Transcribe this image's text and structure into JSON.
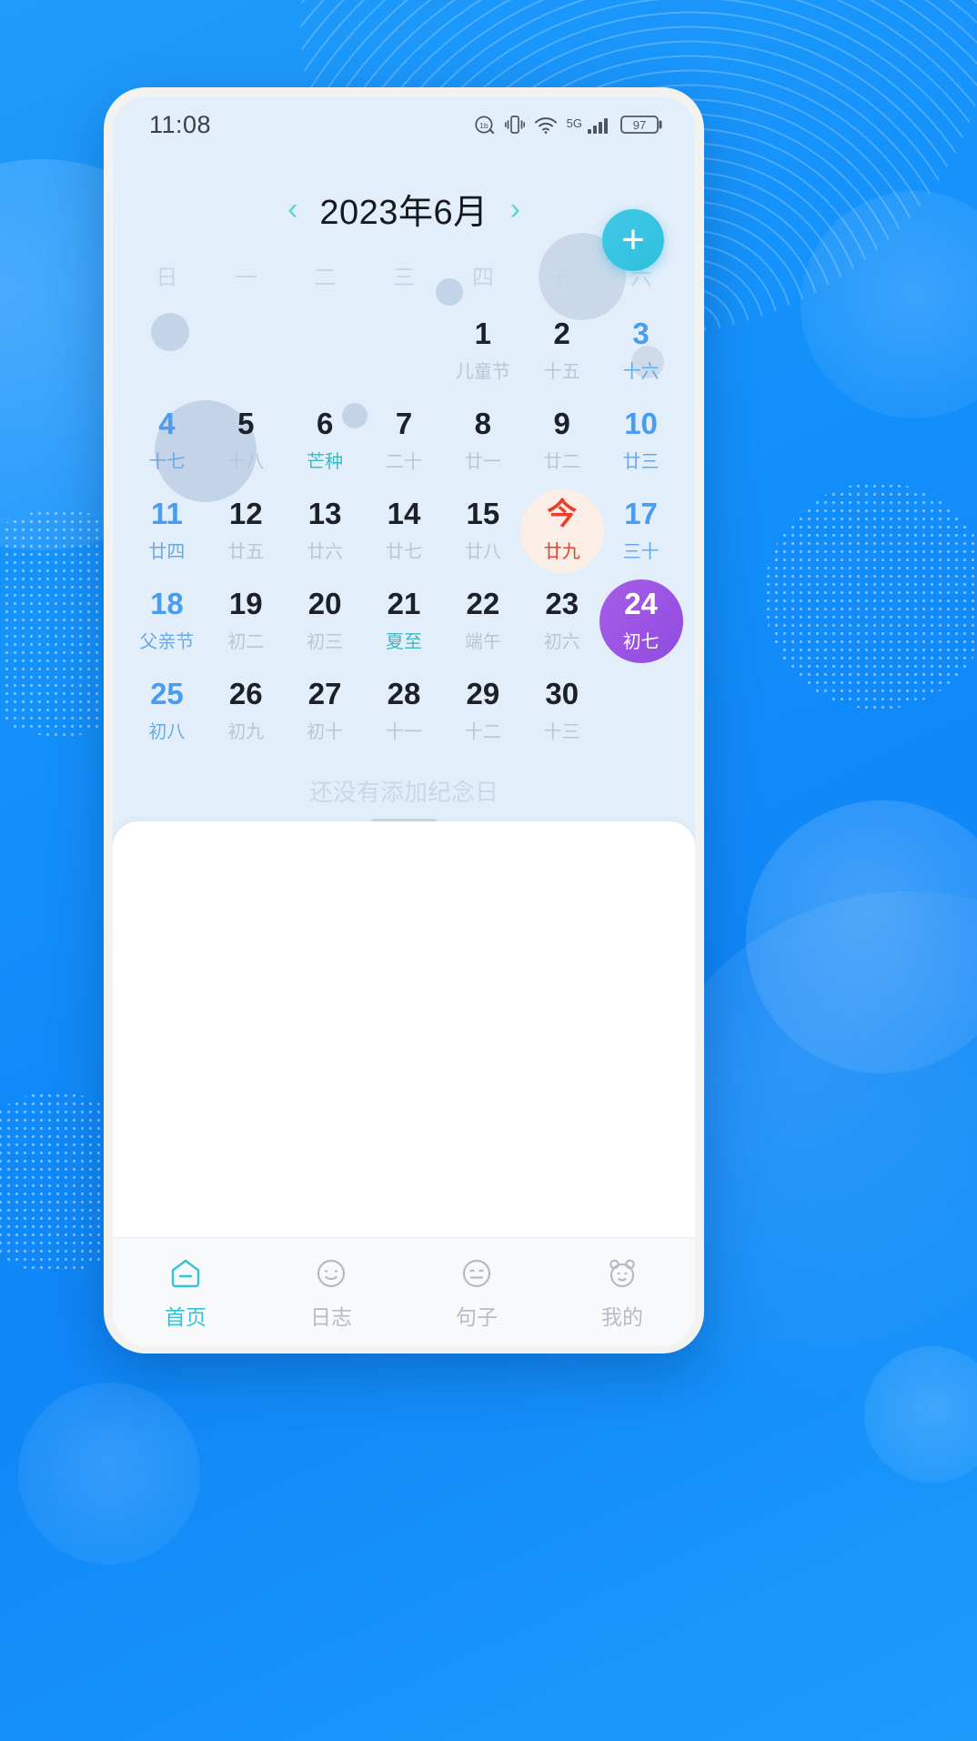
{
  "status_bar": {
    "time": "11:08",
    "network_label": "5G",
    "battery_percent": "97",
    "icons": [
      "alarm-icon",
      "vibrate-icon",
      "wifi-icon",
      "signal-icon",
      "battery-icon"
    ]
  },
  "calendar": {
    "prev_label": "‹",
    "next_label": "›",
    "month_title": "2023年6月",
    "add_label": "+",
    "weekdays": [
      "日",
      "一",
      "二",
      "三",
      "四",
      "五",
      "六"
    ],
    "empty_hint": "还没有添加纪念日",
    "accent_today": "#e8402c",
    "accent_selected": "#8e4ce0",
    "accent_term": "#3fb8c4",
    "accent_weekend": "#4a9cf0",
    "days": [
      {
        "num": "",
        "lunar": "",
        "kind": "empty"
      },
      {
        "num": "",
        "lunar": "",
        "kind": "empty"
      },
      {
        "num": "",
        "lunar": "",
        "kind": "empty"
      },
      {
        "num": "",
        "lunar": "",
        "kind": "empty"
      },
      {
        "num": "1",
        "lunar": "儿童节",
        "kind": "fest"
      },
      {
        "num": "2",
        "lunar": "十五",
        "kind": "normal"
      },
      {
        "num": "3",
        "lunar": "十六",
        "kind": "sat"
      },
      {
        "num": "4",
        "lunar": "十七",
        "kind": "sun"
      },
      {
        "num": "5",
        "lunar": "十八",
        "kind": "normal"
      },
      {
        "num": "6",
        "lunar": "芒种",
        "kind": "term"
      },
      {
        "num": "7",
        "lunar": "二十",
        "kind": "normal"
      },
      {
        "num": "8",
        "lunar": "廿一",
        "kind": "normal"
      },
      {
        "num": "9",
        "lunar": "廿二",
        "kind": "normal"
      },
      {
        "num": "10",
        "lunar": "廿三",
        "kind": "sat"
      },
      {
        "num": "11",
        "lunar": "廿四",
        "kind": "sun"
      },
      {
        "num": "12",
        "lunar": "廿五",
        "kind": "normal"
      },
      {
        "num": "13",
        "lunar": "廿六",
        "kind": "normal"
      },
      {
        "num": "14",
        "lunar": "廿七",
        "kind": "normal"
      },
      {
        "num": "15",
        "lunar": "廿八",
        "kind": "normal"
      },
      {
        "num": "今",
        "lunar": "廿九",
        "kind": "today"
      },
      {
        "num": "17",
        "lunar": "三十",
        "kind": "sat"
      },
      {
        "num": "18",
        "lunar": "父亲节",
        "kind": "sun"
      },
      {
        "num": "19",
        "lunar": "初二",
        "kind": "normal"
      },
      {
        "num": "20",
        "lunar": "初三",
        "kind": "normal"
      },
      {
        "num": "21",
        "lunar": "夏至",
        "kind": "term"
      },
      {
        "num": "22",
        "lunar": "端午",
        "kind": "fest"
      },
      {
        "num": "23",
        "lunar": "初六",
        "kind": "normal"
      },
      {
        "num": "24",
        "lunar": "初七",
        "kind": "selected"
      },
      {
        "num": "25",
        "lunar": "初八",
        "kind": "sun"
      },
      {
        "num": "26",
        "lunar": "初九",
        "kind": "normal"
      },
      {
        "num": "27",
        "lunar": "初十",
        "kind": "normal"
      },
      {
        "num": "28",
        "lunar": "十一",
        "kind": "normal"
      },
      {
        "num": "29",
        "lunar": "十二",
        "kind": "normal"
      },
      {
        "num": "30",
        "lunar": "十三",
        "kind": "normal"
      },
      {
        "num": "",
        "lunar": "",
        "kind": "empty"
      }
    ]
  },
  "bottom_nav": {
    "items": [
      {
        "label": "首页",
        "icon": "home-icon",
        "active": true
      },
      {
        "label": "日志",
        "icon": "journal-face-icon",
        "active": false
      },
      {
        "label": "句子",
        "icon": "quote-face-icon",
        "active": false
      },
      {
        "label": "我的",
        "icon": "profile-bear-icon",
        "active": false
      }
    ]
  }
}
